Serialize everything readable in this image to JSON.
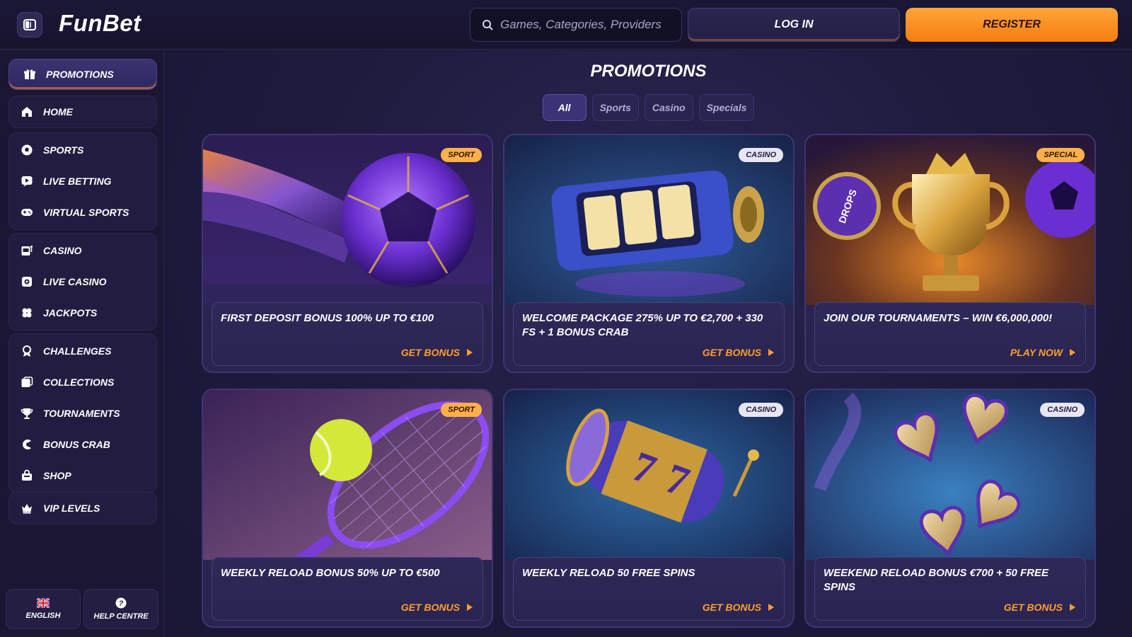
{
  "header": {
    "logo": "FunBet",
    "search_placeholder": "Games, Categories, Providers",
    "login_label": "LOG IN",
    "register_label": "REGISTER"
  },
  "sidebar": {
    "promotions": "PROMOTIONS",
    "groups": [
      [
        {
          "label": "HOME",
          "icon": "home-icon"
        }
      ],
      [
        {
          "label": "SPORTS",
          "icon": "soccer-ball-icon"
        },
        {
          "label": "LIVE BETTING",
          "icon": "live-betting-icon"
        },
        {
          "label": "VIRTUAL SPORTS",
          "icon": "gamepad-icon"
        }
      ],
      [
        {
          "label": "CASINO",
          "icon": "slot-machine-icon"
        },
        {
          "label": "LIVE CASINO",
          "icon": "live-casino-icon"
        },
        {
          "label": "JACKPOTS",
          "icon": "clover-icon"
        }
      ],
      [
        {
          "label": "CHALLENGES",
          "icon": "medal-icon"
        },
        {
          "label": "COLLECTIONS",
          "icon": "collections-icon"
        },
        {
          "label": "TOURNAMENTS",
          "icon": "trophy-icon"
        },
        {
          "label": "BONUS CRAB",
          "icon": "crab-icon"
        },
        {
          "label": "SHOP",
          "icon": "shop-icon"
        }
      ],
      [
        {
          "label": "VIP LEVELS",
          "icon": "crown-icon"
        }
      ]
    ],
    "language": "ENGLISH",
    "help": "HELP CENTRE"
  },
  "main": {
    "title": "PROMOTIONS",
    "filters": [
      "All",
      "Sports",
      "Casino",
      "Specials"
    ],
    "active_filter": "All",
    "cards": [
      {
        "badge": "SPORT",
        "title": "FIRST DEPOSIT BONUS 100% UP TO €100",
        "cta": "GET BONUS"
      },
      {
        "badge": "CASINO",
        "title": "WELCOME PACKAGE 275% UP TO €2,700 + 330 FS + 1 BONUS CRAB",
        "cta": "GET BONUS"
      },
      {
        "badge": "SPECIAL",
        "title": "JOIN OUR TOURNAMENTS – WIN €6,000,000!",
        "cta": "PLAY NOW"
      },
      {
        "badge": "SPORT",
        "title": "WEEKLY RELOAD BONUS 50% UP TO €500",
        "cta": "GET BONUS"
      },
      {
        "badge": "CASINO",
        "title": "WEEKLY RELOAD 50 FREE SPINS",
        "cta": "GET BONUS"
      },
      {
        "badge": "CASINO",
        "title": "WEEKEND RELOAD BONUS €700 + 50 FREE SPINS",
        "cta": "GET BONUS"
      }
    ]
  },
  "colors": {
    "background": "#1c1836",
    "accent_orange": "#f57d10",
    "cta_orange": "#ff9e2c",
    "card_bg": "#2a2450"
  }
}
